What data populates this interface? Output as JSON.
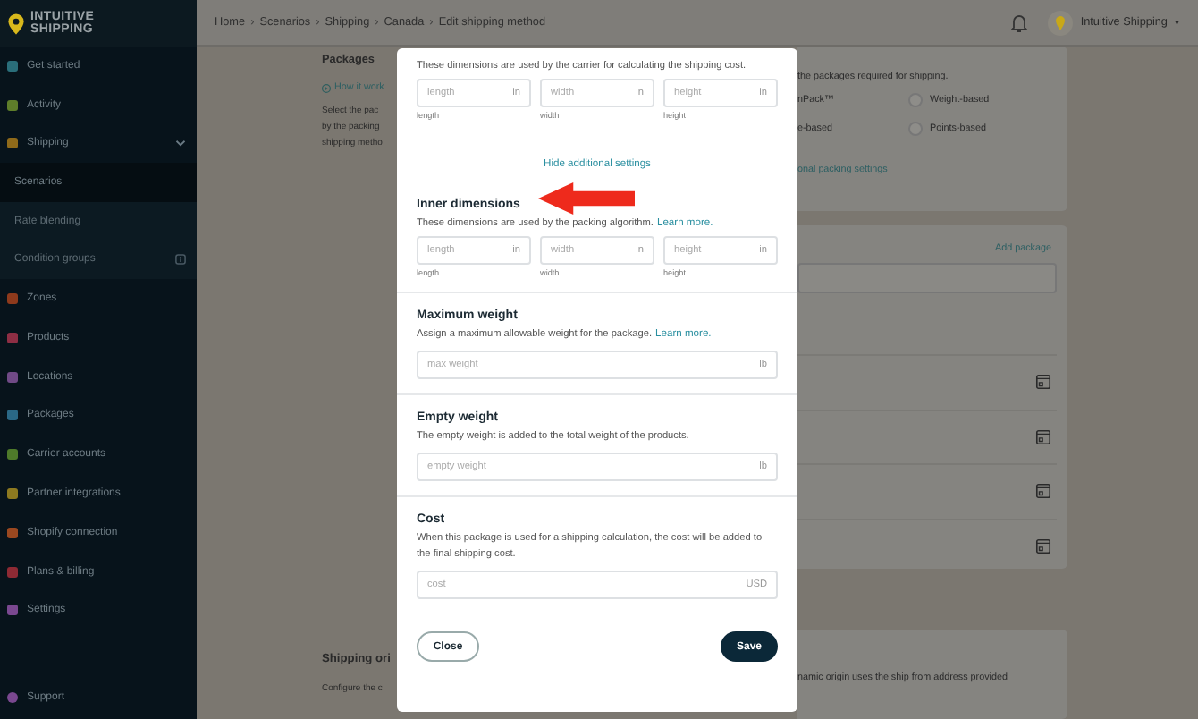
{
  "sidebar": {
    "logo": [
      "INTUITIVE",
      "SHIPPING"
    ],
    "items": [
      {
        "label": "Get started",
        "color": "#2a6e7a"
      },
      {
        "label": "Activity",
        "color": "#5e7e2a"
      },
      {
        "label": "Shipping",
        "color": "#8f6a1a",
        "expanded": true,
        "children": [
          {
            "label": "Scenarios",
            "selected": true,
            "info": false
          },
          {
            "label": "Rate blending",
            "selected": false,
            "info": false
          },
          {
            "label": "Condition groups",
            "selected": false,
            "info": true
          }
        ]
      },
      {
        "label": "Zones",
        "color": "#8e3a1c"
      },
      {
        "label": "Products",
        "color": "#8e2e44"
      },
      {
        "label": "Locations",
        "color": "#704a86"
      },
      {
        "label": "Packages",
        "color": "#2a6886"
      },
      {
        "label": "Carrier accounts",
        "color": "#4e7a2a"
      },
      {
        "label": "Partner integrations",
        "color": "#8e7a20"
      },
      {
        "label": "Shopify connection",
        "color": "#9a4820"
      },
      {
        "label": "Plans & billing",
        "color": "#8e2a34"
      },
      {
        "label": "Settings",
        "color": "#7a4890"
      }
    ],
    "support": {
      "label": "Support",
      "color": "#7a4890"
    }
  },
  "topbar": {
    "breadcrumb": [
      "Home",
      "Scenarios",
      "Shipping",
      "Canada",
      "Edit shipping method"
    ],
    "separator": "›",
    "account": "Intuitive Shipping",
    "caret": "▾"
  },
  "background": {
    "packages_title": "Packages",
    "help_link": "How it work",
    "lines": [
      "Select the pac",
      "by the packing",
      "shipping metho"
    ],
    "intro": "the packages required for shipping.",
    "options": [
      {
        "kind": "text",
        "label": "nPack™"
      },
      {
        "kind": "radio",
        "label": "Weight-based",
        "selected": false
      },
      {
        "kind": "text",
        "label": "e-based"
      },
      {
        "kind": "radio",
        "label": "Points-based",
        "selected": false
      }
    ],
    "packing_link": "onal packing settings",
    "add_link": "Add package",
    "origin_title": "Shipping ori",
    "origin_text": "Configure the c",
    "origin_text_right": "namic origin uses the ship from address provided"
  },
  "modal": {
    "outer": {
      "description": "These dimensions are used by the carrier for calculating the shipping cost.",
      "fields": [
        {
          "placeholder": "length",
          "unit": "in",
          "label": "length"
        },
        {
          "placeholder": "width",
          "unit": "in",
          "label": "width"
        },
        {
          "placeholder": "height",
          "unit": "in",
          "label": "height"
        }
      ]
    },
    "toggle_link": "Hide additional settings",
    "sections": [
      {
        "kind": "dims",
        "title": "Inner dimensions",
        "description": "These dimensions are used by the packing algorithm.",
        "link": "Learn more.",
        "fields": [
          {
            "placeholder": "length",
            "unit": "in",
            "label": "length"
          },
          {
            "placeholder": "width",
            "unit": "in",
            "label": "width"
          },
          {
            "placeholder": "height",
            "unit": "in",
            "label": "height"
          }
        ]
      },
      {
        "kind": "single",
        "title": "Maximum weight",
        "description": "Assign a maximum allowable weight for the package.",
        "link": "Learn more.",
        "field": {
          "placeholder": "max weight",
          "unit": "lb"
        }
      },
      {
        "kind": "single",
        "title": "Empty weight",
        "description": "The empty weight is added to the total weight of the products.",
        "field": {
          "placeholder": "empty weight",
          "unit": "lb"
        }
      },
      {
        "kind": "single",
        "title": "Cost",
        "description": "When this package is used for a shipping calculation, the cost will be added to the final shipping cost.",
        "field": {
          "placeholder": "cost",
          "unit": "USD"
        }
      }
    ],
    "close": "Close",
    "save": "Save"
  }
}
